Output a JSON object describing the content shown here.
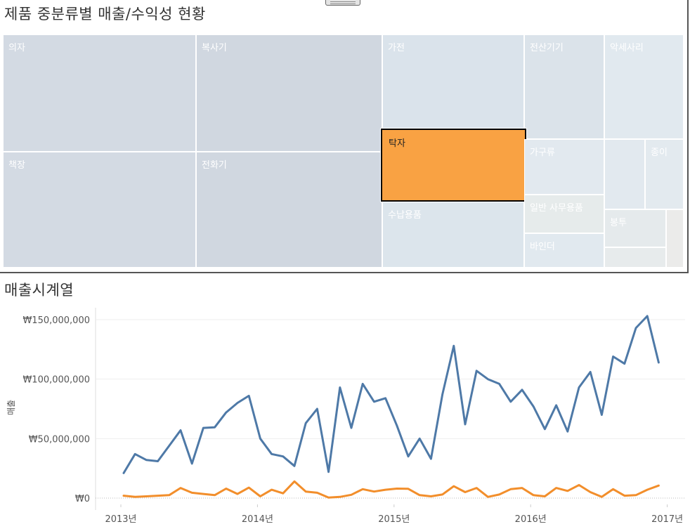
{
  "titles": {
    "treemap": "제품 중분류별 매출/수익성 현황",
    "timeseries": "매출시계열"
  },
  "colors": {
    "selected": "#f9a243",
    "series_sales": "#4e79a7",
    "series_profit": "#f28e2b",
    "shade_dark": "#d0d7e0",
    "shade_mid": "#dae3eb",
    "shade_light": "#e2e9ef",
    "shade_pale": "#e5eaec",
    "shade_gray": "#ebebea"
  },
  "treemap": {
    "cells": [
      {
        "label": "의자",
        "shade": "#d3dae3",
        "selected": false
      },
      {
        "label": "복사기",
        "shade": "#d0d7e0",
        "selected": false
      },
      {
        "label": "가전",
        "shade": "#dae3eb",
        "selected": false
      },
      {
        "label": "전산기기",
        "shade": "#dbe3ea",
        "selected": false
      },
      {
        "label": "악세사리",
        "shade": "#e1e9ef",
        "selected": false
      },
      {
        "label": "책장",
        "shade": "#d3dae3",
        "selected": false
      },
      {
        "label": "전화기",
        "shade": "#d0d7e0",
        "selected": false
      },
      {
        "label": "탁자",
        "shade": "#f9a243",
        "selected": true
      },
      {
        "label": "수납용품",
        "shade": "#dce5ec",
        "selected": false
      },
      {
        "label": "가구류",
        "shade": "#e2e9ef",
        "selected": false
      },
      {
        "label": "",
        "shade": "#e2e9ef",
        "selected": false
      },
      {
        "label": "종이",
        "shade": "#e3eaef",
        "selected": false
      },
      {
        "label": "일반 사무용품",
        "shade": "#e6ebeb",
        "selected": false
      },
      {
        "label": "봉투",
        "shade": "#e5eaec",
        "selected": false
      },
      {
        "label": "",
        "shade": "#ebebea",
        "selected": false
      },
      {
        "label": "바인더",
        "shade": "#e1e9ef",
        "selected": false
      },
      {
        "label": "",
        "shade": "#e7ebec",
        "selected": false
      }
    ]
  },
  "chart_data": {
    "type": "line",
    "title": "매출시계열",
    "ylabel": "매출",
    "x_ticks": [
      "2013년",
      "2014년",
      "2015년",
      "2016년",
      "2017년"
    ],
    "y_ticks": [
      "₩150,000,000",
      "₩100,000,000",
      "₩50,000,000",
      "₩0"
    ],
    "ylim": [
      0,
      160000000
    ],
    "grid": true,
    "x_unit": "month index from Jan 2013",
    "x": [
      0,
      1,
      2,
      3,
      4,
      5,
      6,
      7,
      8,
      9,
      10,
      11,
      12,
      13,
      14,
      15,
      16,
      17,
      18,
      19,
      20,
      21,
      22,
      23,
      24,
      25,
      26,
      27,
      28,
      29,
      30,
      31,
      32,
      33,
      34,
      35,
      36,
      37,
      38,
      39,
      40,
      41,
      42,
      43,
      44,
      45,
      46,
      47
    ],
    "series": [
      {
        "name": "매출",
        "values": [
          21000000,
          37000000,
          32000000,
          31000000,
          44000000,
          57000000,
          29000000,
          59000000,
          59500000,
          72000000,
          80000000,
          86000000,
          50000000,
          37000000,
          35000000,
          27000000,
          63000000,
          75000000,
          22000000,
          93000000,
          59000000,
          96000000,
          81000000,
          84000000,
          61000000,
          35000000,
          50000000,
          33000000,
          87000000,
          128000000,
          62000000,
          107000000,
          100000000,
          96000000,
          81000000,
          91000000,
          77000000,
          58000000,
          78000000,
          56000000,
          93000000,
          106000000,
          70000000,
          119000000,
          113000000,
          143000000,
          153000000,
          114000000
        ]
      },
      {
        "name": "수익",
        "values": [
          2000000,
          1000000,
          1500000,
          2000000,
          2500000,
          8500000,
          4500000,
          3500000,
          2500000,
          8000000,
          3500000,
          8800000,
          1500000,
          7000000,
          4000000,
          14000000,
          5500000,
          4500000,
          500000,
          1000000,
          2800000,
          7500000,
          5500000,
          7000000,
          8000000,
          7800000,
          2500000,
          1500000,
          3000000,
          10000000,
          5000000,
          8500000,
          1000000,
          3000000,
          7500000,
          8500000,
          2500000,
          1500000,
          8500000,
          6000000,
          11000000,
          5000000,
          1000000,
          7500000,
          2000000,
          2500000,
          7000000,
          10500000
        ]
      }
    ]
  }
}
